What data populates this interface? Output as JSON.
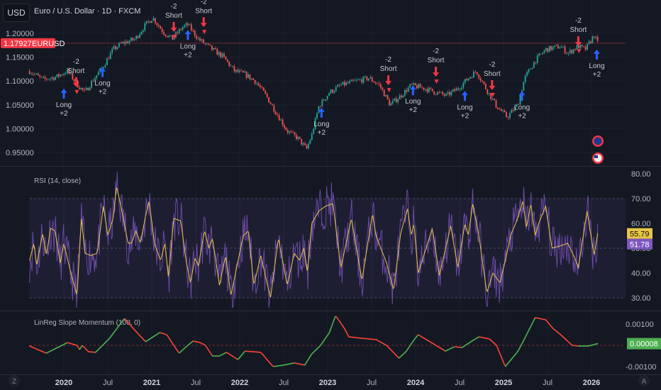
{
  "header": {
    "currency": "USD",
    "title": "Euro / U.S. Dollar · 1D · FXCM"
  },
  "colors": {
    "up": "#26a69a",
    "down": "#ef5350",
    "rsi": "#7e57c2",
    "rsi_ma": "#e8c547",
    "mom_up": "#4caf50",
    "mom_down": "#f44336",
    "long": "#2962ff",
    "short": "#f23645"
  },
  "price_tag": {
    "value": "1.17927",
    "symbol": "EURUSD"
  },
  "rsi_title": "RSI (14, close)",
  "mom_title": "LinReg Slope Momentum (100, 0)",
  "rsi_tags": {
    "ma": "55.79",
    "rsi": "51.78"
  },
  "mom_tag": "0.00008",
  "bottom": {
    "z_button": "Z",
    "a_button": "A"
  },
  "chart_data": [
    {
      "type": "candlestick",
      "title": "Euro / U.S. Dollar · 1D · FXCM",
      "ylim": [
        0.93,
        1.265
      ],
      "y_ticks": [
        "1.20000",
        "1.15000",
        "1.10000",
        "1.05000",
        "1.00000",
        "0.95000"
      ],
      "y_tick_values": [
        1.2,
        1.15,
        1.1,
        1.05,
        1.0,
        0.95
      ],
      "x_ticks": [
        "2020",
        "Jul",
        "2021",
        "Jul",
        "2022",
        "Jul",
        "2023",
        "Jul",
        "2024",
        "Jul",
        "2025",
        "Jul",
        "2026"
      ],
      "x_tick_values": [
        2020,
        2020.5,
        2021,
        2021.5,
        2022,
        2022.5,
        2023,
        2023.5,
        2024,
        2024.5,
        2025,
        2025.5,
        2026
      ],
      "price_path": [
        [
          2019.61,
          1.121
        ],
        [
          2019.76,
          1.103
        ],
        [
          2019.92,
          1.109
        ],
        [
          2020.04,
          1.121
        ],
        [
          2020.16,
          1.091
        ],
        [
          2020.24,
          1.076
        ],
        [
          2020.32,
          1.099
        ],
        [
          2020.44,
          1.129
        ],
        [
          2020.56,
          1.166
        ],
        [
          2020.65,
          1.178
        ],
        [
          2020.81,
          1.188
        ],
        [
          2020.93,
          1.218
        ],
        [
          2021.01,
          1.233
        ],
        [
          2021.13,
          1.203
        ],
        [
          2021.23,
          1.188
        ],
        [
          2021.35,
          1.213
        ],
        [
          2021.41,
          1.218
        ],
        [
          2021.53,
          1.188
        ],
        [
          2021.69,
          1.166
        ],
        [
          2021.81,
          1.151
        ],
        [
          2021.94,
          1.121
        ],
        [
          2022.06,
          1.114
        ],
        [
          2022.18,
          1.099
        ],
        [
          2022.3,
          1.069
        ],
        [
          2022.42,
          1.032
        ],
        [
          2022.54,
          0.995
        ],
        [
          2022.66,
          0.98
        ],
        [
          2022.76,
          0.957
        ],
        [
          2022.82,
          0.987
        ],
        [
          2022.9,
          1.047
        ],
        [
          2023.02,
          1.076
        ],
        [
          2023.15,
          1.091
        ],
        [
          2023.31,
          1.099
        ],
        [
          2023.47,
          1.106
        ],
        [
          2023.59,
          1.091
        ],
        [
          2023.71,
          1.05
        ],
        [
          2023.83,
          1.069
        ],
        [
          2023.95,
          1.091
        ],
        [
          2024.11,
          1.084
        ],
        [
          2024.23,
          1.076
        ],
        [
          2024.35,
          1.069
        ],
        [
          2024.48,
          1.084
        ],
        [
          2024.6,
          1.106
        ],
        [
          2024.69,
          1.121
        ],
        [
          2024.8,
          1.084
        ],
        [
          2024.92,
          1.047
        ],
        [
          2025.04,
          1.024
        ],
        [
          2025.16,
          1.05
        ],
        [
          2025.24,
          1.106
        ],
        [
          2025.36,
          1.143
        ],
        [
          2025.48,
          1.166
        ],
        [
          2025.65,
          1.173
        ],
        [
          2025.73,
          1.158
        ],
        [
          2025.85,
          1.173
        ],
        [
          2025.93,
          1.166
        ],
        [
          2026.03,
          1.196
        ],
        [
          2026.07,
          1.179
        ]
      ],
      "signals": [
        {
          "kind": "long",
          "t": 2020.0,
          "price": 1.084,
          "label": "Long",
          "qty": "+2"
        },
        {
          "kind": "short",
          "t": 2020.14,
          "price": 1.087,
          "label": "Short",
          "qty": "-2"
        },
        {
          "kind": "long",
          "t": 2020.44,
          "price": 1.129,
          "label": "Long",
          "qty": "+2"
        },
        {
          "kind": "short",
          "t": 2021.25,
          "price": 1.203,
          "label": "Short",
          "qty": "-2"
        },
        {
          "kind": "long",
          "t": 2021.41,
          "price": 1.207,
          "label": "Long",
          "qty": "+2"
        },
        {
          "kind": "short",
          "t": 2021.59,
          "price": 1.213,
          "label": "Short",
          "qty": "-2"
        },
        {
          "kind": "long",
          "t": 2022.93,
          "price": 1.044,
          "label": "Long",
          "qty": "+2"
        },
        {
          "kind": "short",
          "t": 2023.69,
          "price": 1.091,
          "label": "Short",
          "qty": "-2"
        },
        {
          "kind": "long",
          "t": 2023.97,
          "price": 1.091,
          "label": "Long",
          "qty": "+2"
        },
        {
          "kind": "short",
          "t": 2024.23,
          "price": 1.109,
          "label": "Short",
          "qty": "-2"
        },
        {
          "kind": "long",
          "t": 2024.56,
          "price": 1.079,
          "label": "Long",
          "qty": "+2"
        },
        {
          "kind": "short",
          "t": 2024.87,
          "price": 1.081,
          "label": "Short",
          "qty": "-2"
        },
        {
          "kind": "long",
          "t": 2025.21,
          "price": 1.079,
          "label": "Long",
          "qty": "+2"
        },
        {
          "kind": "short",
          "t": 2025.85,
          "price": 1.173,
          "label": "Short",
          "qty": "-2"
        },
        {
          "kind": "long",
          "t": 2026.06,
          "price": 1.166,
          "label": "Long",
          "qty": "+2"
        }
      ]
    },
    {
      "type": "line",
      "title": "RSI (14, close)",
      "ylim": [
        25,
        83
      ],
      "y_ticks": [
        "80.00",
        "70.00",
        "60.00",
        "50.00",
        "40.00",
        "30.00"
      ],
      "y_tick_values": [
        80,
        70,
        60,
        50,
        40,
        30
      ],
      "bands": {
        "upper": 70,
        "middle": 50,
        "lower": 30
      },
      "rsi_ma_path": [
        [
          2019.61,
          45
        ],
        [
          2019.66,
          52
        ],
        [
          2019.69,
          43
        ],
        [
          2019.76,
          56
        ],
        [
          2019.8,
          47
        ],
        [
          2019.85,
          58
        ],
        [
          2019.9,
          57
        ],
        [
          2019.96,
          44
        ],
        [
          2020.0,
          52
        ],
        [
          2020.08,
          40
        ],
        [
          2020.15,
          31
        ],
        [
          2020.2,
          62
        ],
        [
          2020.24,
          48
        ],
        [
          2020.31,
          47
        ],
        [
          2020.38,
          48
        ],
        [
          2020.45,
          67
        ],
        [
          2020.5,
          55
        ],
        [
          2020.56,
          62
        ],
        [
          2020.6,
          75
        ],
        [
          2020.66,
          65
        ],
        [
          2020.73,
          52
        ],
        [
          2020.77,
          52
        ],
        [
          2020.82,
          57
        ],
        [
          2020.87,
          52
        ],
        [
          2020.93,
          63
        ],
        [
          2020.97,
          69
        ],
        [
          2021.03,
          52
        ],
        [
          2021.1,
          45
        ],
        [
          2021.15,
          52
        ],
        [
          2021.19,
          38
        ],
        [
          2021.25,
          62
        ],
        [
          2021.33,
          61
        ],
        [
          2021.39,
          45
        ],
        [
          2021.44,
          36
        ],
        [
          2021.49,
          46
        ],
        [
          2021.53,
          43
        ],
        [
          2021.6,
          57
        ],
        [
          2021.65,
          50
        ],
        [
          2021.69,
          54
        ],
        [
          2021.77,
          35
        ],
        [
          2021.84,
          47
        ],
        [
          2021.9,
          31
        ],
        [
          2022.04,
          55
        ],
        [
          2022.1,
          57
        ],
        [
          2022.16,
          35
        ],
        [
          2022.24,
          47
        ],
        [
          2022.35,
          30
        ],
        [
          2022.44,
          54
        ],
        [
          2022.54,
          35
        ],
        [
          2022.62,
          48
        ],
        [
          2022.68,
          45
        ],
        [
          2022.73,
          50
        ],
        [
          2022.77,
          40
        ],
        [
          2022.82,
          60
        ],
        [
          2022.9,
          65
        ],
        [
          2022.98,
          67
        ],
        [
          2023.06,
          68
        ],
        [
          2023.15,
          42
        ],
        [
          2023.27,
          62
        ],
        [
          2023.39,
          37
        ],
        [
          2023.51,
          64
        ],
        [
          2023.55,
          55
        ],
        [
          2023.67,
          44
        ],
        [
          2023.75,
          33
        ],
        [
          2023.83,
          56
        ],
        [
          2023.91,
          66
        ],
        [
          2023.95,
          55
        ],
        [
          2023.98,
          60
        ],
        [
          2024.03,
          40
        ],
        [
          2024.19,
          58
        ],
        [
          2024.27,
          39
        ],
        [
          2024.4,
          59
        ],
        [
          2024.48,
          42
        ],
        [
          2024.56,
          60
        ],
        [
          2024.6,
          55
        ],
        [
          2024.65,
          68
        ],
        [
          2024.72,
          55
        ],
        [
          2024.81,
          32
        ],
        [
          2024.88,
          40
        ],
        [
          2024.96,
          36
        ],
        [
          2025.02,
          45
        ],
        [
          2025.08,
          55
        ],
        [
          2025.16,
          62
        ],
        [
          2025.22,
          69
        ],
        [
          2025.26,
          58
        ],
        [
          2025.31,
          68
        ],
        [
          2025.36,
          55
        ],
        [
          2025.4,
          60
        ],
        [
          2025.48,
          67
        ],
        [
          2025.55,
          50
        ],
        [
          2025.65,
          51
        ],
        [
          2025.73,
          52
        ],
        [
          2025.81,
          46
        ],
        [
          2025.85,
          42
        ],
        [
          2025.95,
          65
        ],
        [
          2026.03,
          47
        ],
        [
          2026.07,
          56
        ]
      ],
      "last_rsi": 51.78,
      "last_ma": 55.79
    },
    {
      "type": "line",
      "title": "LinReg Slope Momentum (100, 0)",
      "ylim": [
        -0.0014,
        0.0016
      ],
      "y_ticks": [
        "0.00100",
        "-0.00100"
      ],
      "y_tick_values": [
        0.001,
        -0.001
      ],
      "zero_line": 0,
      "path": [
        [
          2019.61,
          -3e-05
        ],
        [
          2019.8,
          -0.00037
        ],
        [
          2019.98,
          0
        ],
        [
          2020.04,
          0.00013
        ],
        [
          2020.15,
          0
        ],
        [
          2020.18,
          -0.0002
        ],
        [
          2020.21,
          0
        ],
        [
          2020.28,
          -0.0003
        ],
        [
          2020.36,
          -0.00033
        ],
        [
          2020.44,
          0
        ],
        [
          2020.52,
          0.00033
        ],
        [
          2020.69,
          0.00127
        ],
        [
          2020.81,
          0.0007
        ],
        [
          2020.93,
          0.00017
        ],
        [
          2021.09,
          0.0006
        ],
        [
          2021.17,
          0.0005
        ],
        [
          2021.25,
          0
        ],
        [
          2021.31,
          -0.00037
        ],
        [
          2021.41,
          0
        ],
        [
          2021.47,
          0.0002
        ],
        [
          2021.55,
          0.00013
        ],
        [
          2021.61,
          0
        ],
        [
          2021.69,
          -0.0005
        ],
        [
          2021.77,
          -0.0005
        ],
        [
          2021.85,
          -0.00033
        ],
        [
          2021.98,
          -0.00067
        ],
        [
          2022.06,
          -0.00027
        ],
        [
          2022.24,
          -0.00033
        ],
        [
          2022.38,
          -0.001
        ],
        [
          2022.5,
          -0.00093
        ],
        [
          2022.62,
          -0.00083
        ],
        [
          2022.74,
          -0.00093
        ],
        [
          2022.82,
          -0.0004
        ],
        [
          2022.92,
          0
        ],
        [
          2023.02,
          0.0006
        ],
        [
          2023.09,
          0.0014
        ],
        [
          2023.19,
          0.0008
        ],
        [
          2023.24,
          0.0004
        ],
        [
          2023.39,
          0.00033
        ],
        [
          2023.55,
          0.00027
        ],
        [
          2023.67,
          0
        ],
        [
          2023.81,
          -0.0006
        ],
        [
          2023.89,
          -0.0003
        ],
        [
          2023.99,
          0.0003
        ],
        [
          2024.03,
          0.0005
        ],
        [
          2024.23,
          0
        ],
        [
          2024.34,
          -0.00027
        ],
        [
          2024.44,
          -7e-05
        ],
        [
          2024.53,
          -0.0001
        ],
        [
          2024.64,
          0.0002
        ],
        [
          2024.72,
          0.0004
        ],
        [
          2024.84,
          0.0003
        ],
        [
          2024.92,
          0
        ],
        [
          2025.02,
          -0.001
        ],
        [
          2025.16,
          -0.0003
        ],
        [
          2025.2,
          0
        ],
        [
          2025.36,
          0.0013
        ],
        [
          2025.48,
          0.0012
        ],
        [
          2025.56,
          0.0008
        ],
        [
          2025.65,
          0.0005
        ],
        [
          2025.78,
          0
        ],
        [
          2025.85,
          -3e-05
        ],
        [
          2025.97,
          -3e-05
        ],
        [
          2026.07,
          8e-05
        ]
      ],
      "last": 8e-05
    }
  ]
}
